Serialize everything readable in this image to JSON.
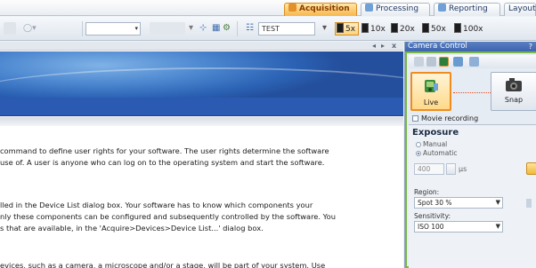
{
  "tabs": [
    {
      "label": "Acquisition",
      "active": true,
      "icon": "camera-icon"
    },
    {
      "label": "Processing",
      "active": false,
      "icon": "processing-icon"
    },
    {
      "label": "Reporting",
      "active": false,
      "icon": "report-icon"
    },
    {
      "label": "Layout",
      "active": false,
      "icon": ""
    }
  ],
  "toolbar": {
    "name_field": "TEST",
    "zoom_levels": [
      "5x",
      "10x",
      "20x",
      "50x",
      "100x"
    ],
    "selected_zoom": "5x"
  },
  "main_window": {
    "nav_prev": "◂",
    "nav_next": "▸",
    "close": "x",
    "paragraphs": [
      "command to define user rights for your software. The user rights determine the software",
      "use of. A user is anyone who can log on to the operating system and start the software.",
      "lled in the Device List dialog box. Your software has to know which components your",
      "nly these components can be configured and subsequently controlled by the software. You",
      "s that are available, in the 'Acquire>Devices>Device List...' dialog box.",
      "evices, such as a camera, a microscope and/or a stage, will be part of your system. Use"
    ]
  },
  "camera_control": {
    "title": "Camera Control",
    "pin": "?",
    "live_label": "Live",
    "snap_label": "Snap",
    "movie_recording": "Movie recording",
    "exposure": {
      "heading": "Exposure",
      "mode_manual": "Manual",
      "mode_automatic": "Automatic",
      "selected_mode": "Automatic",
      "value": "400",
      "unit": "µs"
    },
    "region": {
      "label": "Region:",
      "value": "Spot 30 %"
    },
    "sensitivity": {
      "label": "Sensitivity:",
      "value": "ISO 100"
    }
  },
  "colors": {
    "active_tab": "#f7b64a",
    "panel_border": "#7ab648",
    "live_border": "#f08c1e",
    "banner_blue": "#2a5ab1"
  }
}
